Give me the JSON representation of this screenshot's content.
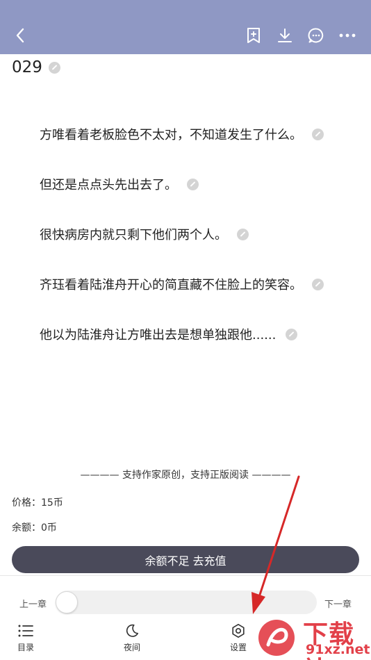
{
  "toolbar": {
    "icons": [
      "back-arrow-icon",
      "bookmark-add-icon",
      "download-icon",
      "comment-icon",
      "more-icon"
    ]
  },
  "chapter": {
    "title": "029",
    "paragraphs": [
      "方唯看着老板脸色不太对，不知道发生了什么。",
      "但还是点点头先出去了。",
      "很快病房内就只剩下他们两个人。",
      "齐珏看着陆淮舟开心的简直藏不住脸上的笑容。",
      "他以为陆淮舟让方唯出去是想单独跟他......"
    ]
  },
  "paywall": {
    "support_text": "———— 支持作家原创，支持正版阅读 ————",
    "price": "价格：15币",
    "balance": "余额：0币",
    "recharge_button": "余额不足 去充值"
  },
  "progress": {
    "prev_label": "上一章",
    "next_label": "下一章",
    "value": 0
  },
  "nav": {
    "toc": "目录",
    "night": "夜间",
    "settings": "设置"
  },
  "watermark": {
    "text": "下载站",
    "url": "91xz.net"
  },
  "colors": {
    "topbar": "#8f98c4",
    "button": "#4a4a5a",
    "annotation_arrow": "#d62828",
    "watermark": "#e0303a"
  }
}
